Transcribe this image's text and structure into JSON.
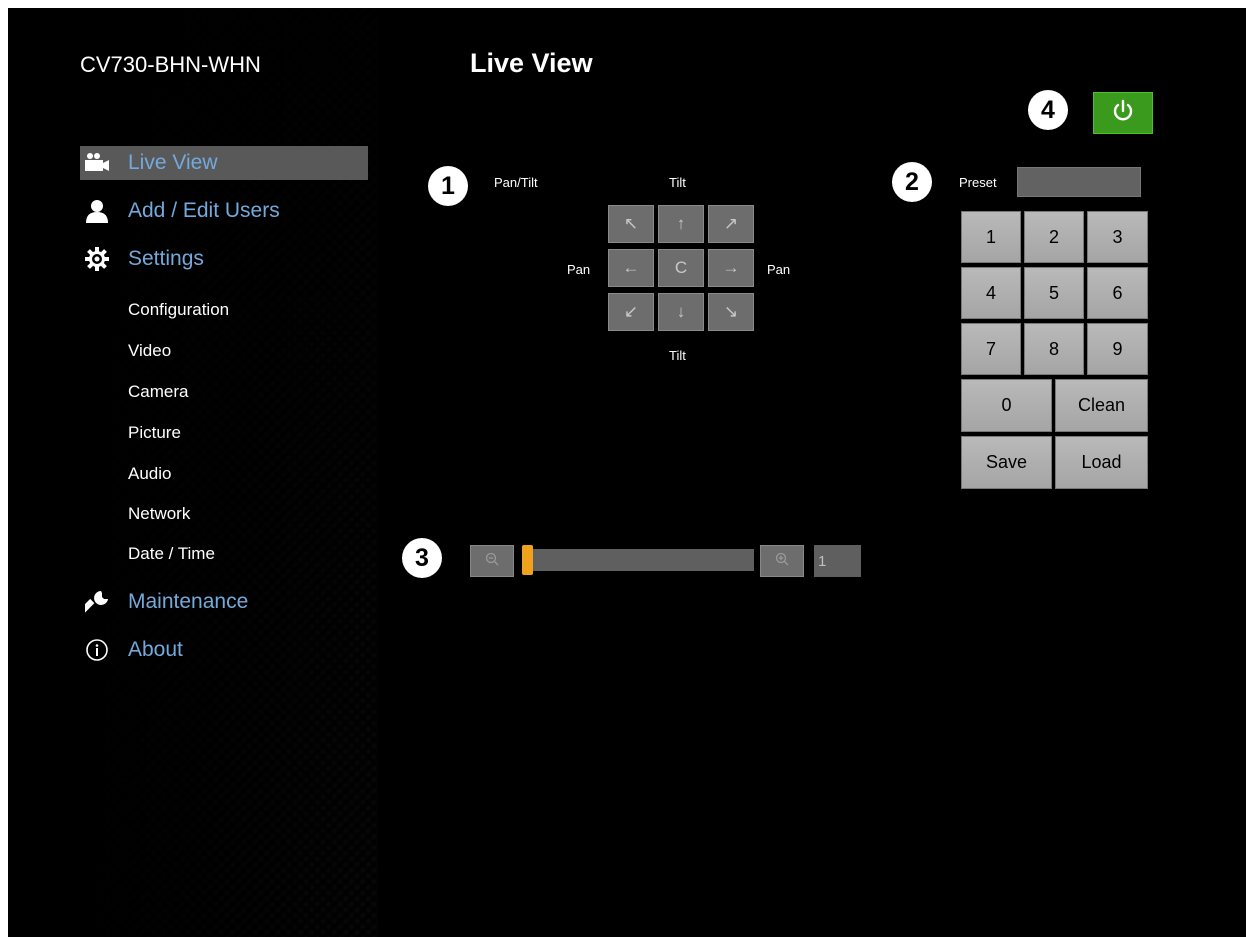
{
  "sidebar": {
    "device_name": "CV730-BHN-WHN",
    "nav": [
      {
        "label": "Live View",
        "icon": "camcorder-icon",
        "active": true
      },
      {
        "label": "Add / Edit Users",
        "icon": "user-icon"
      },
      {
        "label": "Settings",
        "icon": "gear-icon"
      },
      {
        "label": "Maintenance",
        "icon": "wrench-icon"
      },
      {
        "label": "About",
        "icon": "info-icon"
      }
    ],
    "settings_sub": [
      "Configuration",
      "Video",
      "Camera",
      "Picture",
      "Audio",
      "Network",
      "Date / Time"
    ]
  },
  "main": {
    "title": "Live View",
    "callouts": [
      "1",
      "2",
      "3",
      "4"
    ],
    "ptz": {
      "pan_tilt_label": "Pan/Tilt",
      "tilt_top": "Tilt",
      "tilt_bottom": "Tilt",
      "pan_left": "Pan",
      "pan_right": "Pan",
      "buttons": [
        "↖",
        "↑",
        "↗",
        "←",
        "C",
        "→",
        "↙",
        "↓",
        "↘"
      ]
    },
    "preset": {
      "label": "Preset",
      "value": "",
      "keys": [
        "1",
        "2",
        "3",
        "4",
        "5",
        "6",
        "7",
        "8",
        "9"
      ],
      "zero": "0",
      "clean": "Clean",
      "save": "Save",
      "load": "Load"
    },
    "zoom": {
      "value": "1",
      "level": 0
    }
  },
  "colors": {
    "nav_link": "#74a9dc",
    "power": "#3a9a1e",
    "zoom_thumb": "#f0a21c",
    "active_nav_bg": "#595959"
  }
}
